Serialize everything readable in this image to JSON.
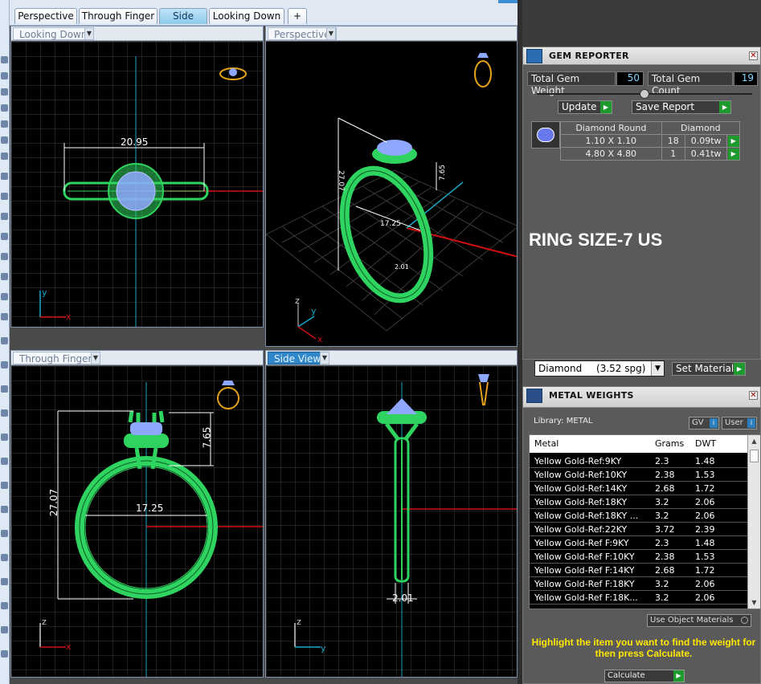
{
  "tabs": [
    {
      "label": "Perspective"
    },
    {
      "label": "Through Finger"
    },
    {
      "label": "Side View"
    },
    {
      "label": "Looking Down"
    },
    {
      "label": "+"
    }
  ],
  "viewports": {
    "top_left": {
      "label": "Looking Down",
      "dimension": "20.95"
    },
    "top_right": {
      "label": "Perspective",
      "dimensions": [
        "27.07",
        "7.65",
        "17.25",
        "2.01"
      ]
    },
    "bottom_left": {
      "label": "Through Finger",
      "dimensions": [
        "27.07",
        "7.65",
        "17.25"
      ]
    },
    "bottom_right": {
      "label": "Side View",
      "dimension": "2.01"
    }
  },
  "axes": {
    "x": "x",
    "y": "y",
    "z": "z"
  },
  "gem_reporter": {
    "title": "GEM REPORTER",
    "total_weight_label": "Total Gem Weight",
    "total_weight_value": "50",
    "total_count_label": "Total Gem Count",
    "total_count_value": "19",
    "update_label": "Update",
    "save_report_label": "Save Report",
    "col_shape": "Diamond Round",
    "col_material": "Diamond",
    "rows": [
      {
        "size": "1.10 X 1.10",
        "count": "18",
        "tw": "0.09tw"
      },
      {
        "size": "4.80 X 4.80",
        "count": "1",
        "tw": "0.41tw"
      }
    ]
  },
  "ring_size": "RING SIZE-7 US",
  "material": {
    "selected_name": "Diamond",
    "selected_sg": "(3.52 spg)",
    "set_material_label": "Set Material"
  },
  "metal_weights": {
    "title": "METAL WEIGHTS",
    "library_label": "Library: METAL",
    "gv_label": "GV",
    "user_label": "User",
    "col_metal": "Metal",
    "col_grams": "Grams",
    "col_dwt": "DWT",
    "rows": [
      {
        "metal": "Yellow Gold-Ref:9KY",
        "grams": "2.3",
        "dwt": "1.48"
      },
      {
        "metal": "Yellow Gold-Ref:10KY",
        "grams": "2.38",
        "dwt": "1.53"
      },
      {
        "metal": "Yellow Gold-Ref:14KY",
        "grams": "2.68",
        "dwt": "1.72"
      },
      {
        "metal": "Yellow Gold-Ref:18KY",
        "grams": "3.2",
        "dwt": "2.06"
      },
      {
        "metal": "Yellow Gold-Ref:18KY ...",
        "grams": "3.2",
        "dwt": "2.06"
      },
      {
        "metal": "Yellow Gold-Ref:22KY",
        "grams": "3.72",
        "dwt": "2.39"
      },
      {
        "metal": "Yellow Gold-Ref F:9KY",
        "grams": "2.3",
        "dwt": "1.48"
      },
      {
        "metal": "Yellow Gold-Ref F:10KY",
        "grams": "2.38",
        "dwt": "1.53"
      },
      {
        "metal": "Yellow Gold-Ref F:14KY",
        "grams": "2.68",
        "dwt": "1.72"
      },
      {
        "metal": "Yellow Gold-Ref F:18KY",
        "grams": "3.2",
        "dwt": "2.06"
      },
      {
        "metal": "Yellow Gold-Ref F:18K...",
        "grams": "3.2",
        "dwt": "2.06"
      }
    ],
    "use_object_materials_label": "Use Object Materials",
    "hint": "Highlight the item you want to find the weight for then press Calculate.",
    "calculate_label": "Calculate"
  },
  "colors": {
    "accent": "#2f86c9",
    "ring": "#2fd35f",
    "gem": "#8fa8ff",
    "grid": "#3a3a3a",
    "axis_x": "#d01010",
    "axis_y": "#1aa7c6",
    "hint": "#ffe800"
  }
}
